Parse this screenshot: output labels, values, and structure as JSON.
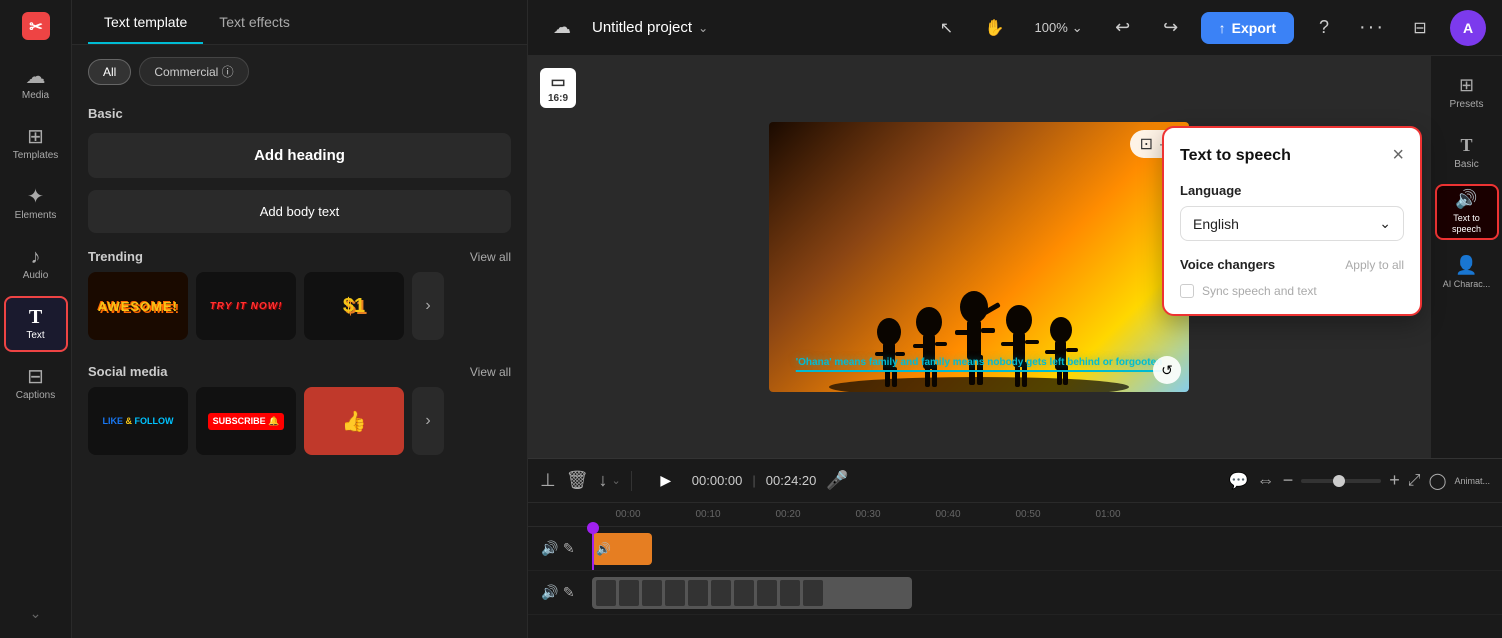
{
  "app": {
    "logo": "✂",
    "project_title": "Untitled project"
  },
  "sidebar": {
    "items": [
      {
        "id": "media",
        "label": "Media",
        "icon": "☁"
      },
      {
        "id": "templates",
        "label": "Templates",
        "icon": "⊞"
      },
      {
        "id": "elements",
        "label": "Elements",
        "icon": "✦"
      },
      {
        "id": "audio",
        "label": "Audio",
        "icon": "♪"
      },
      {
        "id": "text",
        "label": "Text",
        "icon": "T",
        "active": true
      },
      {
        "id": "captions",
        "label": "Captions",
        "icon": "⊟"
      }
    ],
    "arrow": "⌄"
  },
  "text_panel": {
    "tabs": [
      {
        "id": "text-template",
        "label": "Text template",
        "active": true
      },
      {
        "id": "text-effects",
        "label": "Text effects",
        "active": false
      }
    ],
    "filters": [
      {
        "id": "all",
        "label": "All",
        "active": true
      },
      {
        "id": "commercial",
        "label": "Commercial ⓘ",
        "active": false
      }
    ],
    "basic": {
      "label": "Basic",
      "add_heading": "Add heading",
      "add_body": "Add body text"
    },
    "trending": {
      "label": "Trending",
      "view_all": "View all",
      "items": [
        {
          "id": "awesome",
          "text": "AWESOME!",
          "colors": [
            "#f5c518",
            "#ff6b00"
          ]
        },
        {
          "id": "try-it-now",
          "text": "TRY IT NOW!",
          "colors": [
            "#ff0000",
            "#cc0000"
          ]
        },
        {
          "id": "dollar",
          "text": "$1",
          "colors": [
            "#f5c518",
            "#ff6b00"
          ]
        }
      ]
    },
    "social_media": {
      "label": "Social media",
      "view_all": "View all",
      "items": [
        {
          "id": "like-follow",
          "text": "LIKE & FOLLOW",
          "colors": [
            "#1877f2",
            "#f5c518"
          ]
        },
        {
          "id": "subscribe",
          "text": "SUBSCRIBE 🔔",
          "colors": [
            "#ff0000",
            "#fff"
          ]
        },
        {
          "id": "thumbs-up",
          "text": "👍",
          "colors": [
            "#ff0000",
            "#fff"
          ]
        }
      ]
    }
  },
  "topbar": {
    "cloud_icon": "☁",
    "cursor_icon": "↖",
    "hand_icon": "✋",
    "zoom": "100%",
    "undo_icon": "↩",
    "redo_icon": "↪",
    "export_icon": "↑",
    "export_label": "Export",
    "help_icon": "?",
    "more_icon": "•••",
    "split_icon": "⊟",
    "avatar_label": "A"
  },
  "canvas": {
    "aspect_ratio_line1": "□",
    "aspect_ratio_line2": "16:9",
    "caption": "'Ohana' means family and family means nobody gets left behind or forgooten",
    "overlay_icons": [
      "⊡",
      "•••"
    ]
  },
  "tts_panel": {
    "title": "Text to speech",
    "close": "×",
    "language_label": "Language",
    "language_value": "English",
    "voice_changers_label": "Voice changers",
    "apply_all": "Apply to all",
    "sync_label": "Sync speech and text"
  },
  "right_panel": {
    "items": [
      {
        "id": "presets",
        "label": "Presets",
        "icon": "⊞"
      },
      {
        "id": "basic",
        "label": "Basic",
        "icon": "T"
      },
      {
        "id": "tts",
        "label": "Text to\nspeech",
        "icon": "🔊",
        "active": true
      },
      {
        "id": "ai-charac",
        "label": "AI Charac...",
        "icon": "👤"
      }
    ]
  },
  "timeline": {
    "toolbar": {
      "align_icon": "⊥",
      "delete_icon": "🗑",
      "download_icon": "↓",
      "more_icon": "⌄",
      "play_icon": "▶",
      "time_current": "00:00:00",
      "time_total": "00:24:20",
      "mic_icon": "🎤",
      "captions_icon": "💬",
      "align_tl_icon": "⇔",
      "zoom_minus": "−",
      "zoom_plus": "+",
      "expand_icon": "⤢",
      "circle_icon": "◯",
      "anim_label": "Animat..."
    },
    "ruler": [
      "00:00",
      "00:10",
      "00:20",
      "00:30",
      "00:40",
      "00:50",
      "01:00"
    ],
    "tracks": [
      {
        "id": "text-track",
        "side_icons": [
          "📢",
          "✎"
        ],
        "clip_left": 0,
        "clip_width": 30,
        "clip_color": "orange"
      },
      {
        "id": "video-track",
        "side_icons": [
          "📢",
          "✎"
        ],
        "clip_left": 0,
        "clip_width": 260,
        "clip_color": "film"
      }
    ]
  }
}
